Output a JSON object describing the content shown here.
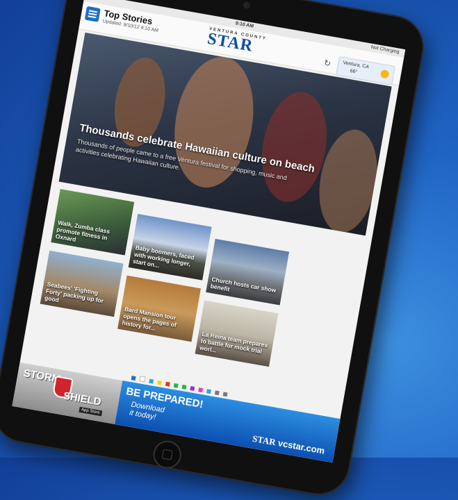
{
  "status_bar": {
    "carrier": "iPad",
    "time": "9:10 AM",
    "battery": "Not Charging"
  },
  "header": {
    "section_title": "Top Stories",
    "updated": "Updated: 9/10/12 9:10 AM",
    "logo_county": "VENTURA COUNTY",
    "logo_star": "STAR",
    "icons": [
      "menu-icon",
      "refresh-icon",
      "sun-icon"
    ]
  },
  "weather": {
    "city": "Ventura, CA",
    "temp": "66°"
  },
  "hero": {
    "headline": "Thousands celebrate Hawaiian culture on beach",
    "summary": "Thousands of people came to a free Ventura festival for shopping, music and activities celebrating Hawaiian culture."
  },
  "stories": [
    {
      "caption": "Walk, Zumba class promote fitness in Oxnard"
    },
    {
      "caption": "Baby boomers, faced with working longer, start on..."
    },
    {
      "caption": "Church hosts car show benefit"
    },
    {
      "caption": "Seabees' 'Fighting Forty' packing up for good"
    },
    {
      "caption": "Bard Mansion tour opens the pages of history for..."
    },
    {
      "caption": "La Reina team prepares to battle for mock trial worl..."
    }
  ],
  "page_dot_colors": [
    "#1d6fc4",
    "#ffffff",
    "#2aa3e6",
    "#f6d31c",
    "#e6321c",
    "#2db24a",
    "#2db24a",
    "#9c2fd6",
    "#ee3aa6",
    "#2aa3e6",
    "#7a7a7a",
    "#7a7a7a"
  ],
  "ad": {
    "storm": "STORM",
    "shield": "SHIELD",
    "app_store": "App Store",
    "be_prepared": "BE PREPARED!",
    "download_1": "Download",
    "download_2": "it today!",
    "url": "vcstar.com"
  }
}
